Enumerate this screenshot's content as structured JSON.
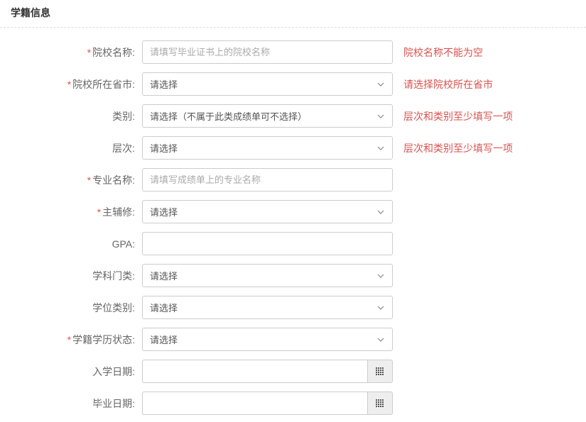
{
  "section_title": "学籍信息",
  "fields": {
    "school_name": {
      "label": "院校名称:",
      "placeholder": "请填写毕业证书上的院校名称",
      "error": "院校名称不能为空"
    },
    "province": {
      "label": "院校所在省市:",
      "selected": "请选择",
      "error": "请选择院校所在省市"
    },
    "category": {
      "label": "类别:",
      "selected": "请选择（不属于此类成绩单可不选择）",
      "error": "层次和类别至少填写一项"
    },
    "level": {
      "label": "层次:",
      "selected": "请选择",
      "error": "层次和类别至少填写一项"
    },
    "major": {
      "label": "专业名称:",
      "placeholder": "请填写成绩单上的专业名称"
    },
    "minor": {
      "label": "主辅修:",
      "selected": "请选择"
    },
    "gpa": {
      "label": "GPA:"
    },
    "subject": {
      "label": "学科门类:",
      "selected": "请选择"
    },
    "degree_type": {
      "label": "学位类别:",
      "selected": "请选择"
    },
    "status": {
      "label": "学籍学历状态:",
      "selected": "请选择"
    },
    "enroll_date": {
      "label": "入学日期:"
    },
    "grad_date": {
      "label": "毕业日期:"
    }
  }
}
